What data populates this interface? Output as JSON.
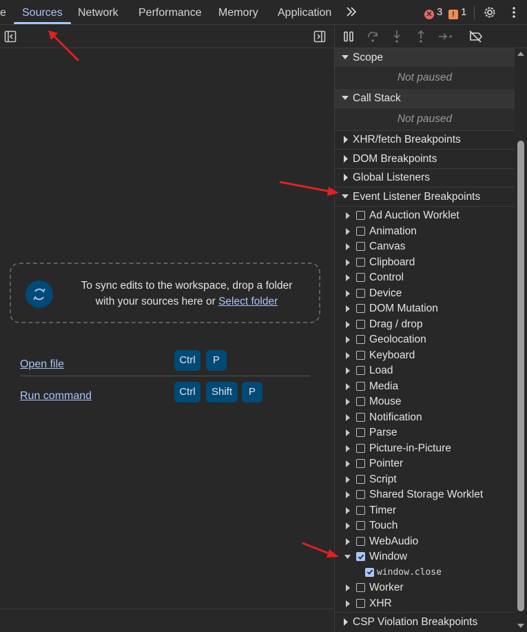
{
  "tabs": [
    {
      "label": "e"
    },
    {
      "label": "Sources"
    },
    {
      "label": "Network"
    },
    {
      "label": "Performance"
    },
    {
      "label": "Memory"
    },
    {
      "label": "Application"
    }
  ],
  "errors_count": "3",
  "warnings_count": "1",
  "dropzone": {
    "line1": "To sync edits to the workspace, drop a folder",
    "line2_prefix": "with your sources here or ",
    "link": "Select folder"
  },
  "shortcuts": [
    {
      "label": "Open file",
      "keys": [
        "Ctrl",
        "P"
      ]
    },
    {
      "label": "Run command",
      "keys": [
        "Ctrl",
        "Shift",
        "P"
      ]
    }
  ],
  "sections": {
    "scope": "Scope",
    "call_stack": "Call Stack",
    "not_paused": "Not paused",
    "xhr": "XHR/fetch Breakpoints",
    "dom": "DOM Breakpoints",
    "global": "Global Listeners",
    "event": "Event Listener Breakpoints",
    "csp": "CSP Violation Breakpoints"
  },
  "event_items": [
    {
      "label": "Ad Auction Worklet",
      "checked": false
    },
    {
      "label": "Animation",
      "checked": false
    },
    {
      "label": "Canvas",
      "checked": false
    },
    {
      "label": "Clipboard",
      "checked": false
    },
    {
      "label": "Control",
      "checked": false
    },
    {
      "label": "Device",
      "checked": false
    },
    {
      "label": "DOM Mutation",
      "checked": false
    },
    {
      "label": "Drag / drop",
      "checked": false
    },
    {
      "label": "Geolocation",
      "checked": false
    },
    {
      "label": "Keyboard",
      "checked": false
    },
    {
      "label": "Load",
      "checked": false
    },
    {
      "label": "Media",
      "checked": false
    },
    {
      "label": "Mouse",
      "checked": false
    },
    {
      "label": "Notification",
      "checked": false
    },
    {
      "label": "Parse",
      "checked": false
    },
    {
      "label": "Picture-in-Picture",
      "checked": false
    },
    {
      "label": "Pointer",
      "checked": false
    },
    {
      "label": "Script",
      "checked": false
    },
    {
      "label": "Shared Storage Worklet",
      "checked": false
    },
    {
      "label": "Timer",
      "checked": false
    },
    {
      "label": "Touch",
      "checked": false
    },
    {
      "label": "WebAudio",
      "checked": false
    },
    {
      "label": "Window",
      "checked": true,
      "expanded": true
    }
  ],
  "window_sub": {
    "label": "window.close",
    "checked": true
  },
  "event_items_after": [
    {
      "label": "Worker",
      "checked": false
    },
    {
      "label": "XHR",
      "checked": false
    }
  ],
  "colors": {
    "background": "#282828",
    "accent": "#a8c7fa",
    "key_bg": "#004a77",
    "error": "#e46962",
    "warning": "#f28b54",
    "annotation_arrow": "#e02020"
  },
  "icons": [
    "more-tabs-icon",
    "error-icon",
    "warning-icon",
    "settings-gear-icon",
    "kebab-menu-icon",
    "toggle-navigator-icon",
    "toggle-debugger-icon",
    "pause-icon",
    "step-over-icon",
    "step-into-icon",
    "step-out-icon",
    "step-icon",
    "deactivate-breakpoints-icon",
    "sync-icon"
  ]
}
